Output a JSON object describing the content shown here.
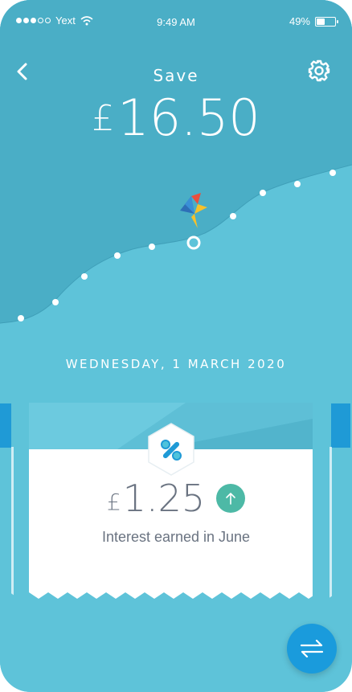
{
  "status_bar": {
    "carrier": "Yext",
    "time": "9:49 AM",
    "battery": "49%",
    "battery_level": 0.49
  },
  "header": {
    "title": "Save",
    "currency_symbol": "£",
    "amount": "16.50"
  },
  "date_label": "WEDNESDAY, 1 MARCH 2020",
  "interest_card": {
    "currency_symbol": "£",
    "amount": "1.25",
    "trend_icon": "arrow-up-icon",
    "caption": "Interest earned in June",
    "badge_icon": "percent-icon"
  },
  "fab": {
    "icon": "transfer-arrows-icon"
  },
  "colors": {
    "background": "#5ec3d9",
    "dark_area": "#4aaec6",
    "accent": "#1a9bdc",
    "trend": "#4db9a6",
    "text_muted": "#6a7381"
  }
}
